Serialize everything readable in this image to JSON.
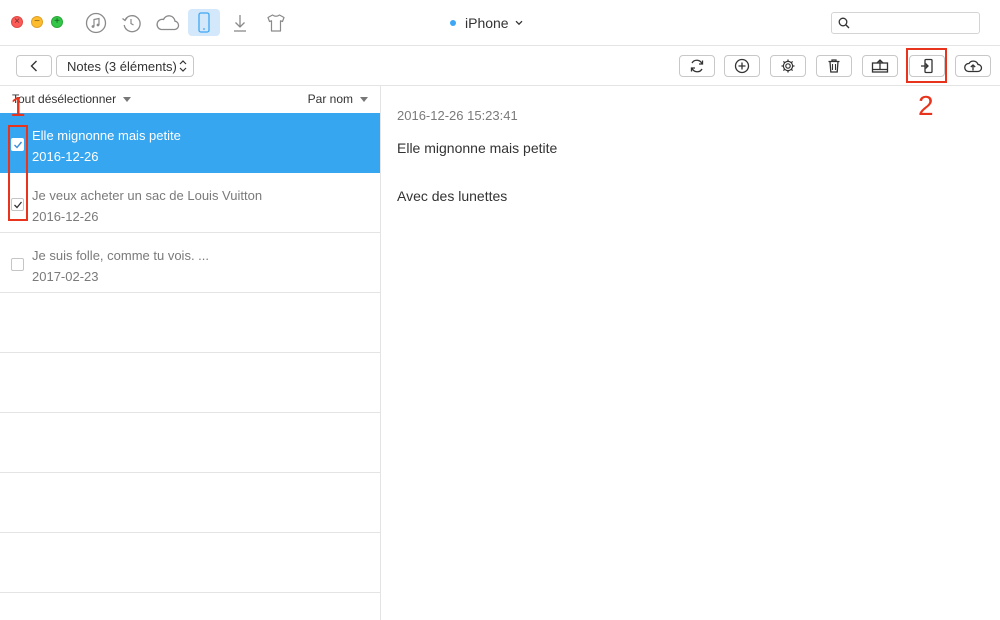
{
  "window": {
    "device_name": "iPhone",
    "search": {
      "placeholder": "",
      "value": ""
    }
  },
  "nav_icons": [
    "music-icon",
    "restore-icon",
    "icloud-icon",
    "iphone-icon",
    "download-icon",
    "tshirt-icon"
  ],
  "toolbar": {
    "category_label": "Notes (3 éléments)",
    "buttons": [
      "refresh-icon",
      "add-icon",
      "settings-icon",
      "delete-icon",
      "export-to-computer-icon",
      "import-to-device-icon",
      "upload-to-cloud-icon"
    ]
  },
  "list": {
    "deselect_label": "Tout désélectionner",
    "sort_label": "Par nom",
    "items": [
      {
        "title": "Elle mignonne mais petite",
        "date": "2016-12-26",
        "checked": true,
        "selected": true
      },
      {
        "title": "Je veux acheter un sac de Louis Vuitton",
        "date": "2016-12-26",
        "checked": true,
        "selected": false
      },
      {
        "title": "Je suis folle, comme tu vois. ...",
        "date": "2017-02-23",
        "checked": false,
        "selected": false
      }
    ]
  },
  "detail": {
    "timestamp": "2016-12-26 15:23:41",
    "lines": [
      "Elle mignonne mais petite",
      "Avec des lunettes"
    ]
  },
  "annotations": {
    "label_1": "1",
    "label_2": "2"
  },
  "colors": {
    "accent": "#37a6f0",
    "annotation": "#e8341c",
    "active_nav": "#d4e8fb"
  }
}
